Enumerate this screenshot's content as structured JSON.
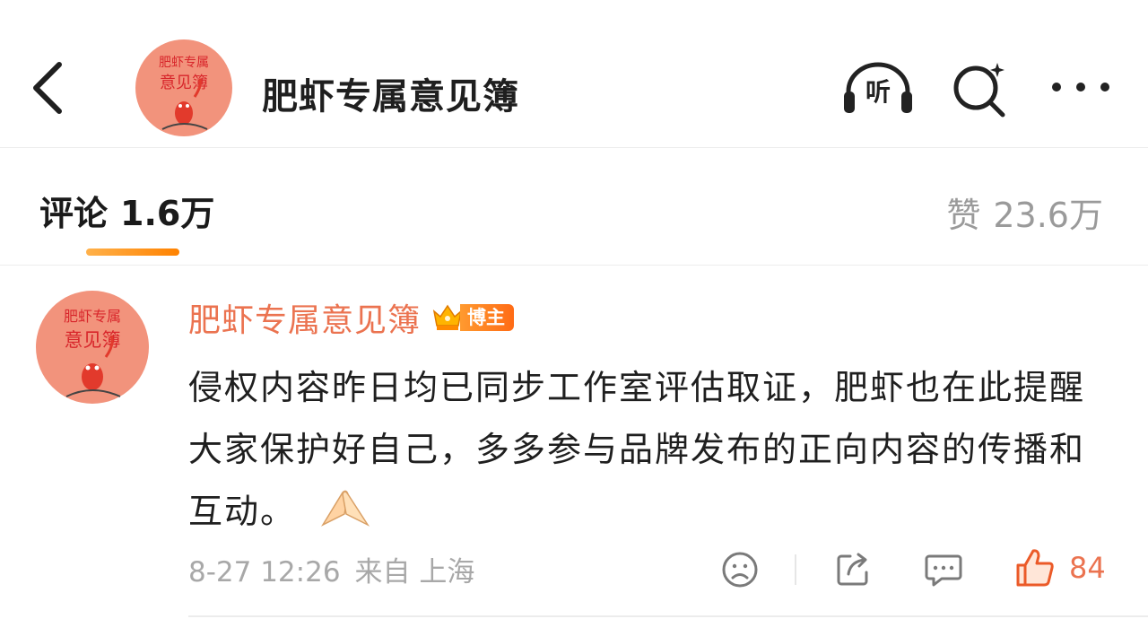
{
  "header": {
    "title": "肥虾专属意见簿",
    "avatar_text_top": "肥虾专属",
    "avatar_text_bottom": "意见簿",
    "listen_label": "听",
    "icons": [
      "back-chevron-icon",
      "listen-headphones-icon",
      "search-icon",
      "more-dots-icon"
    ]
  },
  "tabs": {
    "comments_label": "评论",
    "comments_count": "1.6万",
    "likes_label": "赞",
    "likes_count": "23.6万"
  },
  "comment": {
    "author": "肥虾专属意见簿",
    "badge": "博主",
    "text": "侵权内容昨日均已同步工作室评估取证，肥虾也在此提醒大家保护好自己，多多参与品牌发布的正向内容的传播和互动。",
    "emoji": "pray-hands-emoji",
    "date": "8-27 12:26",
    "source": "来自 上海",
    "like_count": "84",
    "icons": [
      "dislike-face-icon",
      "share-icon",
      "reply-icon",
      "thumbs-up-icon"
    ]
  },
  "colors": {
    "accent": "#eb7350",
    "tab_indicator": "#ff8200",
    "badge": "#ff7a1f",
    "muted": "#a8a8a8"
  }
}
